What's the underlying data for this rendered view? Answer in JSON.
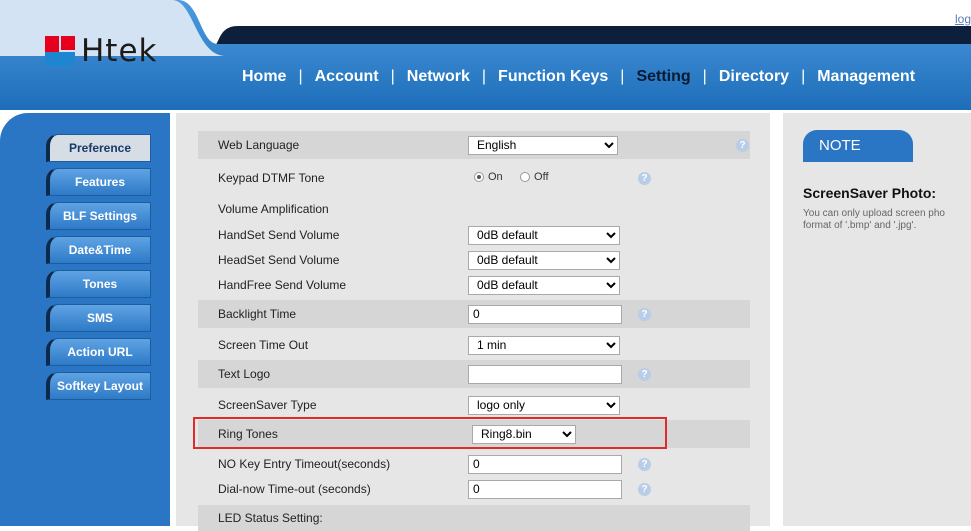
{
  "header": {
    "logo_text": "Htek",
    "logout_label": "log",
    "nav": [
      {
        "label": "Home"
      },
      {
        "label": "Account"
      },
      {
        "label": "Network"
      },
      {
        "label": "Function Keys"
      },
      {
        "label": "Setting",
        "active": true
      },
      {
        "label": "Directory"
      },
      {
        "label": "Management"
      }
    ],
    "colors": {
      "nav_bar": "#2f7dc9",
      "accent_dark": "#0d1f3a"
    }
  },
  "sidebar": {
    "items": [
      {
        "label": "Preference"
      },
      {
        "label": "Features"
      },
      {
        "label": "BLF Settings"
      },
      {
        "label": "Date&Time"
      },
      {
        "label": "Tones"
      },
      {
        "label": "SMS"
      },
      {
        "label": "Action URL"
      },
      {
        "label": "Softkey Layout"
      }
    ]
  },
  "form": {
    "web_language": {
      "label": "Web Language",
      "value": "English"
    },
    "keypad_dtmf": {
      "label": "Keypad DTMF Tone",
      "on_label": "On",
      "off_label": "Off",
      "selected": "On"
    },
    "volume_heading": "Volume Amplification",
    "handset_send": {
      "label": "HandSet Send Volume",
      "value": "0dB default"
    },
    "headset_send": {
      "label": "HeadSet Send Volume",
      "value": "0dB default"
    },
    "handfree_send": {
      "label": "HandFree Send Volume",
      "value": "0dB default"
    },
    "backlight": {
      "label": "Backlight Time",
      "value": "0"
    },
    "screen_timeout": {
      "label": "Screen Time Out",
      "value": "1 min"
    },
    "text_logo": {
      "label": "Text Logo",
      "value": ""
    },
    "screensaver_type": {
      "label": "ScreenSaver Type",
      "value": "logo only"
    },
    "ring_tones": {
      "label": "Ring Tones",
      "value": "Ring8.bin"
    },
    "no_key_timeout": {
      "label": "NO Key Entry Timeout(seconds)",
      "value": "0"
    },
    "dial_now_timeout": {
      "label": "Dial-now Time-out (seconds)",
      "value": "0"
    },
    "led_heading": "LED Status Setting:",
    "help_glyph": "?"
  },
  "note": {
    "tab_label": "NOTE",
    "title": "ScreenSaver Photo:",
    "text": "You can only upload screen pho format of '.bmp' and '.jpg'."
  },
  "highlight_color": "#e02b2b"
}
